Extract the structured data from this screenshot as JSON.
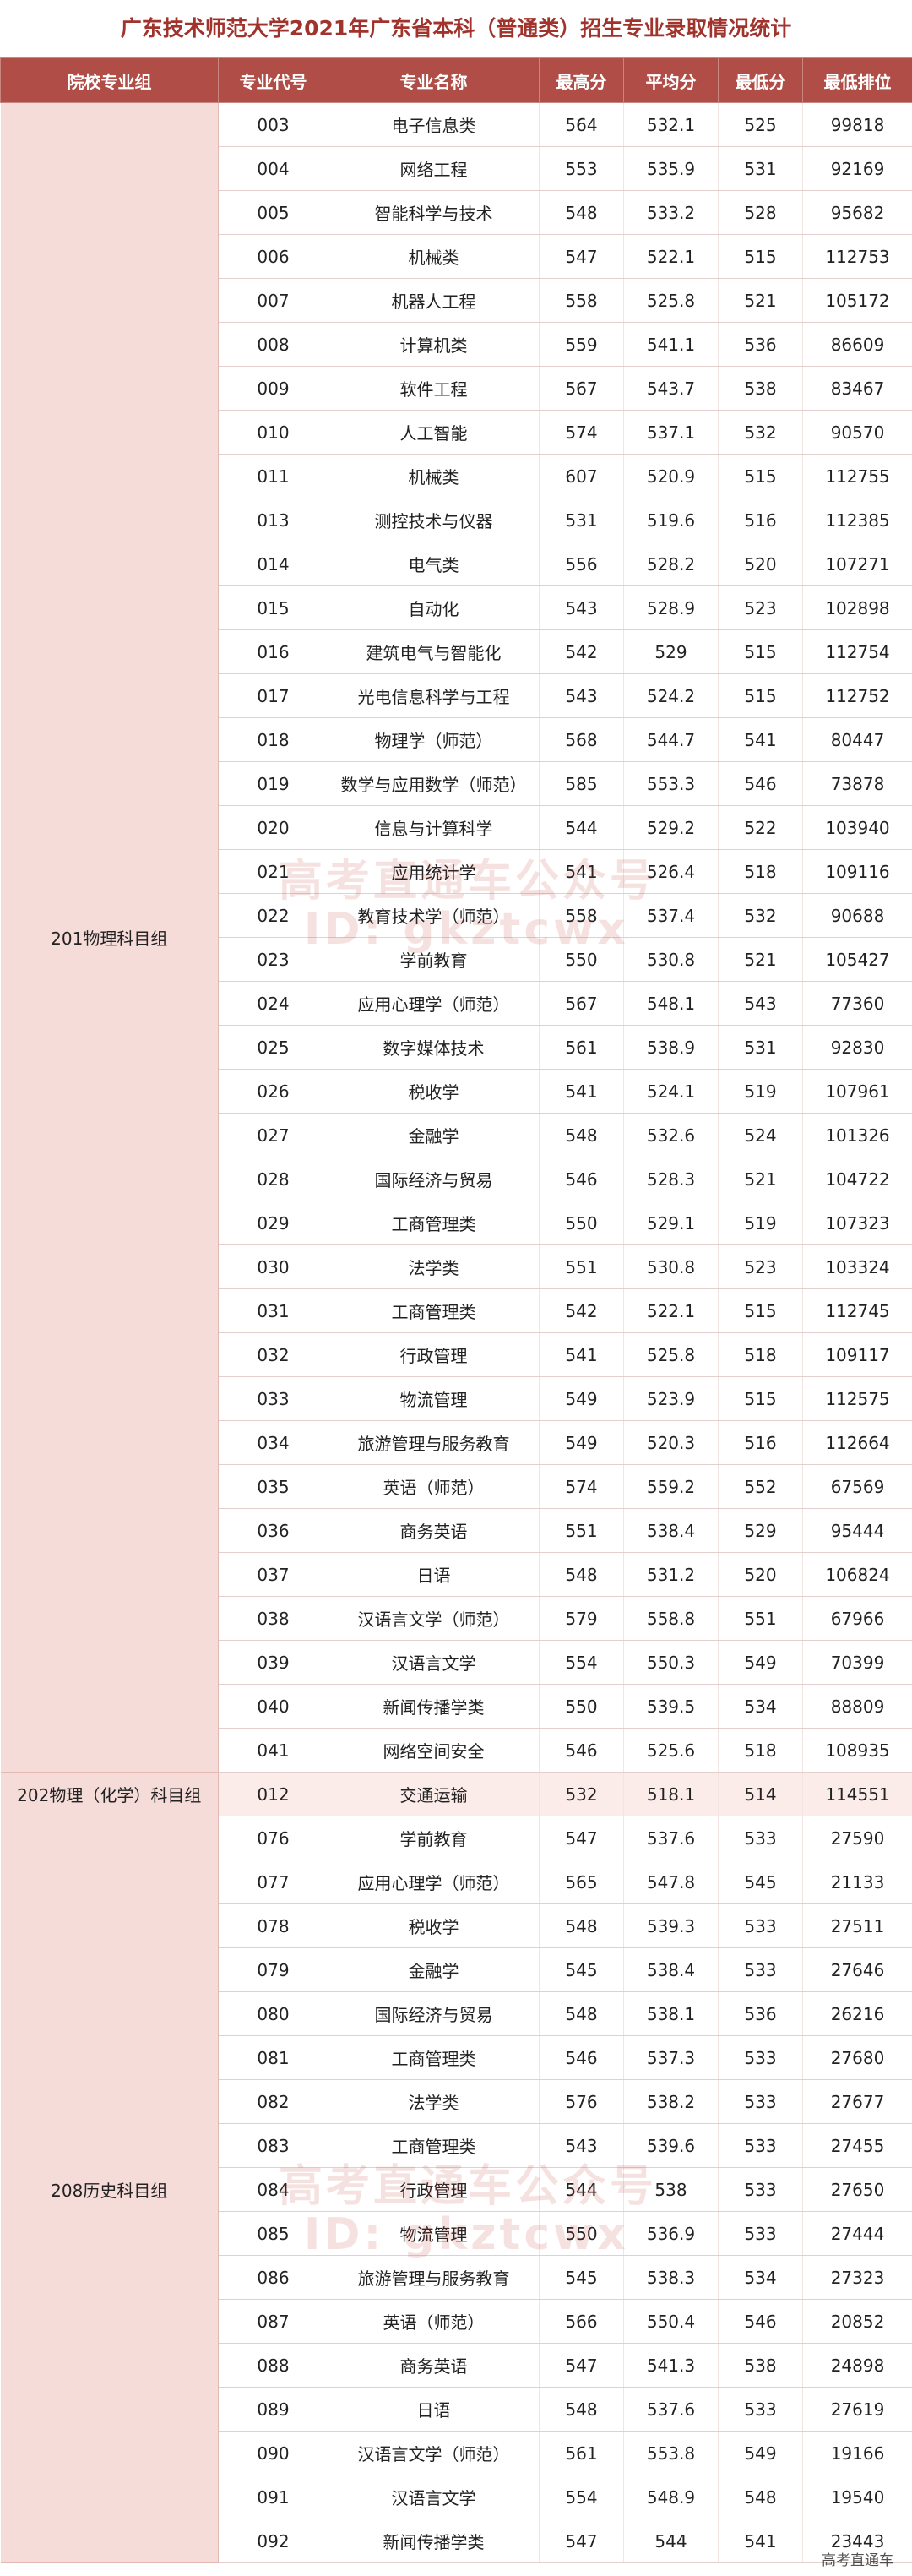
{
  "title": "广东技术师范大学2021年广东省本科（普通类）招生专业录取情况统计",
  "columns": [
    "院校专业组",
    "专业代号",
    "专业名称",
    "最高分",
    "平均分",
    "最低分",
    "最低排位"
  ],
  "groups": [
    {
      "name": "201物理科目组",
      "rows": [
        [
          "003",
          "电子信息类",
          "564",
          "532.1",
          "525",
          "99818"
        ],
        [
          "004",
          "网络工程",
          "553",
          "535.9",
          "531",
          "92169"
        ],
        [
          "005",
          "智能科学与技术",
          "548",
          "533.2",
          "528",
          "95682"
        ],
        [
          "006",
          "机械类",
          "547",
          "522.1",
          "515",
          "112753"
        ],
        [
          "007",
          "机器人工程",
          "558",
          "525.8",
          "521",
          "105172"
        ],
        [
          "008",
          "计算机类",
          "559",
          "541.1",
          "536",
          "86609"
        ],
        [
          "009",
          "软件工程",
          "567",
          "543.7",
          "538",
          "83467"
        ],
        [
          "010",
          "人工智能",
          "574",
          "537.1",
          "532",
          "90570"
        ],
        [
          "011",
          "机械类",
          "607",
          "520.9",
          "515",
          "112755"
        ],
        [
          "013",
          "测控技术与仪器",
          "531",
          "519.6",
          "516",
          "112385"
        ],
        [
          "014",
          "电气类",
          "556",
          "528.2",
          "520",
          "107271"
        ],
        [
          "015",
          "自动化",
          "543",
          "528.9",
          "523",
          "102898"
        ],
        [
          "016",
          "建筑电气与智能化",
          "542",
          "529",
          "515",
          "112754"
        ],
        [
          "017",
          "光电信息科学与工程",
          "543",
          "524.2",
          "515",
          "112752"
        ],
        [
          "018",
          "物理学（师范）",
          "568",
          "544.7",
          "541",
          "80447"
        ],
        [
          "019",
          "数学与应用数学（师范）",
          "585",
          "553.3",
          "546",
          "73878"
        ],
        [
          "020",
          "信息与计算科学",
          "544",
          "529.2",
          "522",
          "103940"
        ],
        [
          "021",
          "应用统计学",
          "541",
          "526.4",
          "518",
          "109116"
        ],
        [
          "022",
          "教育技术学（师范）",
          "558",
          "537.4",
          "532",
          "90688"
        ],
        [
          "023",
          "学前教育",
          "550",
          "530.8",
          "521",
          "105427"
        ],
        [
          "024",
          "应用心理学（师范）",
          "567",
          "548.1",
          "543",
          "77360"
        ],
        [
          "025",
          "数字媒体技术",
          "561",
          "538.9",
          "531",
          "92830"
        ],
        [
          "026",
          "税收学",
          "541",
          "524.1",
          "519",
          "107961"
        ],
        [
          "027",
          "金融学",
          "548",
          "532.6",
          "524",
          "101326"
        ],
        [
          "028",
          "国际经济与贸易",
          "546",
          "528.3",
          "521",
          "104722"
        ],
        [
          "029",
          "工商管理类",
          "550",
          "529.1",
          "519",
          "107323"
        ],
        [
          "030",
          "法学类",
          "551",
          "530.8",
          "523",
          "103324"
        ],
        [
          "031",
          "工商管理类",
          "542",
          "522.1",
          "515",
          "112745"
        ],
        [
          "032",
          "行政管理",
          "541",
          "525.8",
          "518",
          "109117"
        ],
        [
          "033",
          "物流管理",
          "549",
          "523.9",
          "515",
          "112575"
        ],
        [
          "034",
          "旅游管理与服务教育",
          "549",
          "520.3",
          "516",
          "112664"
        ],
        [
          "035",
          "英语（师范）",
          "574",
          "559.2",
          "552",
          "67569"
        ],
        [
          "036",
          "商务英语",
          "551",
          "538.4",
          "529",
          "95444"
        ],
        [
          "037",
          "日语",
          "548",
          "531.2",
          "520",
          "106824"
        ],
        [
          "038",
          "汉语言文学（师范）",
          "579",
          "558.8",
          "551",
          "67966"
        ],
        [
          "039",
          "汉语言文学",
          "554",
          "550.3",
          "549",
          "70399"
        ],
        [
          "040",
          "新闻传播学类",
          "550",
          "539.5",
          "534",
          "88809"
        ],
        [
          "041",
          "网络空间安全",
          "546",
          "525.6",
          "518",
          "108935"
        ]
      ]
    },
    {
      "name": "202物理（化学）科目组",
      "rows": [
        [
          "012",
          "交通运输",
          "532",
          "518.1",
          "514",
          "114551"
        ]
      ]
    },
    {
      "name": "208历史科目组",
      "rows": [
        [
          "076",
          "学前教育",
          "547",
          "537.6",
          "533",
          "27590"
        ],
        [
          "077",
          "应用心理学（师范）",
          "565",
          "547.8",
          "545",
          "21133"
        ],
        [
          "078",
          "税收学",
          "548",
          "539.3",
          "533",
          "27511"
        ],
        [
          "079",
          "金融学",
          "545",
          "538.4",
          "533",
          "27646"
        ],
        [
          "080",
          "国际经济与贸易",
          "548",
          "538.1",
          "536",
          "26216"
        ],
        [
          "081",
          "工商管理类",
          "546",
          "537.3",
          "533",
          "27680"
        ],
        [
          "082",
          "法学类",
          "576",
          "538.2",
          "533",
          "27677"
        ],
        [
          "083",
          "工商管理类",
          "543",
          "539.6",
          "533",
          "27455"
        ],
        [
          "084",
          "行政管理",
          "544",
          "538",
          "533",
          "27650"
        ],
        [
          "085",
          "物流管理",
          "550",
          "536.9",
          "533",
          "27444"
        ],
        [
          "086",
          "旅游管理与服务教育",
          "545",
          "538.3",
          "534",
          "27323"
        ],
        [
          "087",
          "英语（师范）",
          "566",
          "550.4",
          "546",
          "20852"
        ],
        [
          "088",
          "商务英语",
          "547",
          "541.3",
          "538",
          "24898"
        ],
        [
          "089",
          "日语",
          "548",
          "537.6",
          "533",
          "27619"
        ],
        [
          "090",
          "汉语言文学（师范）",
          "561",
          "553.8",
          "549",
          "19166"
        ],
        [
          "091",
          "汉语言文学",
          "554",
          "548.9",
          "548",
          "19540"
        ],
        [
          "092",
          "新闻传播学类",
          "547",
          "544",
          "541",
          "23443"
        ]
      ]
    }
  ],
  "watermark": "高考直通车公众号 ID: gkztcwx",
  "footer": "高考直通车"
}
